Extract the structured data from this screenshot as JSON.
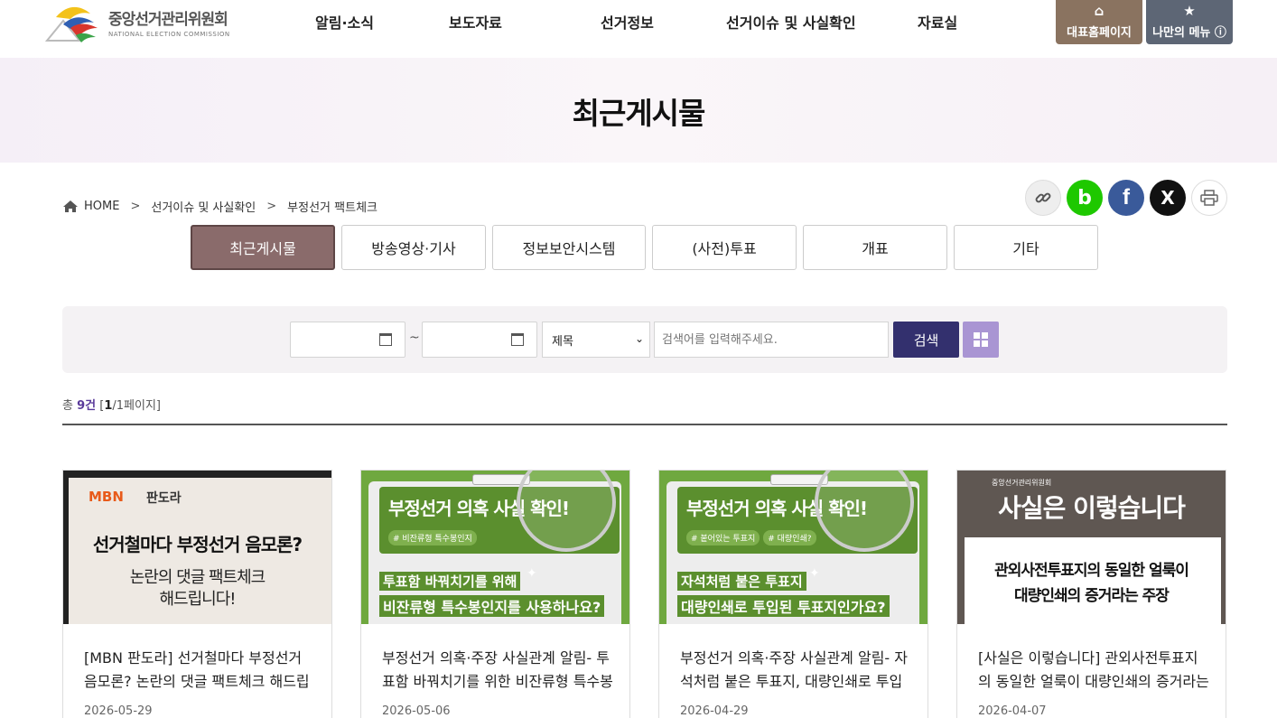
{
  "header": {
    "logo_ko": "중앙선거관리위원회",
    "logo_en": "NATIONAL ELECTION COMMISSION",
    "menu": [
      "알림·소식",
      "보도자료",
      "선거정보",
      "선거이슈 및 사실확인",
      "자료실"
    ],
    "home_button": "대표홈페이지",
    "mymenu_button": "나만의 메뉴 ⓘ"
  },
  "page_title": "최근게시물",
  "breadcrumb": [
    "HOME",
    "선거이슈 및 사실확인",
    "부정선거 팩트체크"
  ],
  "share": {
    "blog_label": "b",
    "x_label": "X",
    "facebook_label": "f"
  },
  "tabs": [
    "최근게시물",
    "방송영상·기사",
    "정보보안시스템",
    "(사전)투표",
    "개표",
    "기타"
  ],
  "active_tab": "최근게시물",
  "search": {
    "tilde": "~",
    "field_selected": "제목",
    "placeholder": "검색어를 입력해주세요.",
    "button": "검색"
  },
  "result": {
    "prefix": "총",
    "count": "9건",
    "page_open": "[",
    "page_current": "1",
    "page_rest": "/1페이지]"
  },
  "cards": [
    {
      "title": "[MBN 판도라] 선거철마다 부정선거 음모론? 논란의 댓글 팩트체크 해드립니다!",
      "date": "2026-05-29",
      "thumb": {
        "brand": "MBN",
        "brand2": "판도라",
        "headline": "선거철마다 부정선거 음모론?",
        "sub1": "논란의 댓글 팩트체크",
        "sub2": "해드립니다!"
      }
    },
    {
      "title": "부정선거 의혹·주장 사실관계 알림- 투표함 바꿔치기를 위한 비잔류형 특수봉인지",
      "date": "2026-05-06",
      "thumb": {
        "headline": "부정선거 의혹 사실 확인!",
        "tags": [
          "# 비잔류형 특수봉인지"
        ],
        "line1": "투표함 바꿔치기를 위해",
        "line2": "비잔류형 특수봉인지를 사용하나요?"
      }
    },
    {
      "title": "부정선거 의혹·주장 사실관계 알림- 자석처럼 붙은 투표지, 대량인쇄로 투입된 투표지",
      "date": "2026-04-29",
      "thumb": {
        "headline": "부정선거 의혹 사실 확인!",
        "tags": [
          "# 붙어있는 투표지",
          "# 대량인쇄?"
        ],
        "line1": "자석처럼 붙은 투표지",
        "line2": "대량인쇄로 투입된 투표지인가요?"
      }
    },
    {
      "title": "[사실은 이렇습니다] 관외사전투표지의 동일한 얼룩이 대량인쇄의 증거라는 주장",
      "date": "2026-04-07",
      "thumb": {
        "logo": "중앙선거관리위원회",
        "headline": "사실은 이렇습니다",
        "line1": "관외사전투표지의 동일한 얼룩이",
        "line2": "대량인쇄의 증거라는 주장"
      }
    }
  ],
  "colors": {
    "active_tab": "#8a6b6b",
    "search_button": "#33306e",
    "grid_button": "#a995d3",
    "home_button": "#8a7360",
    "mymenu_button": "#5d6675",
    "thumb_green": "#6fa83f"
  }
}
